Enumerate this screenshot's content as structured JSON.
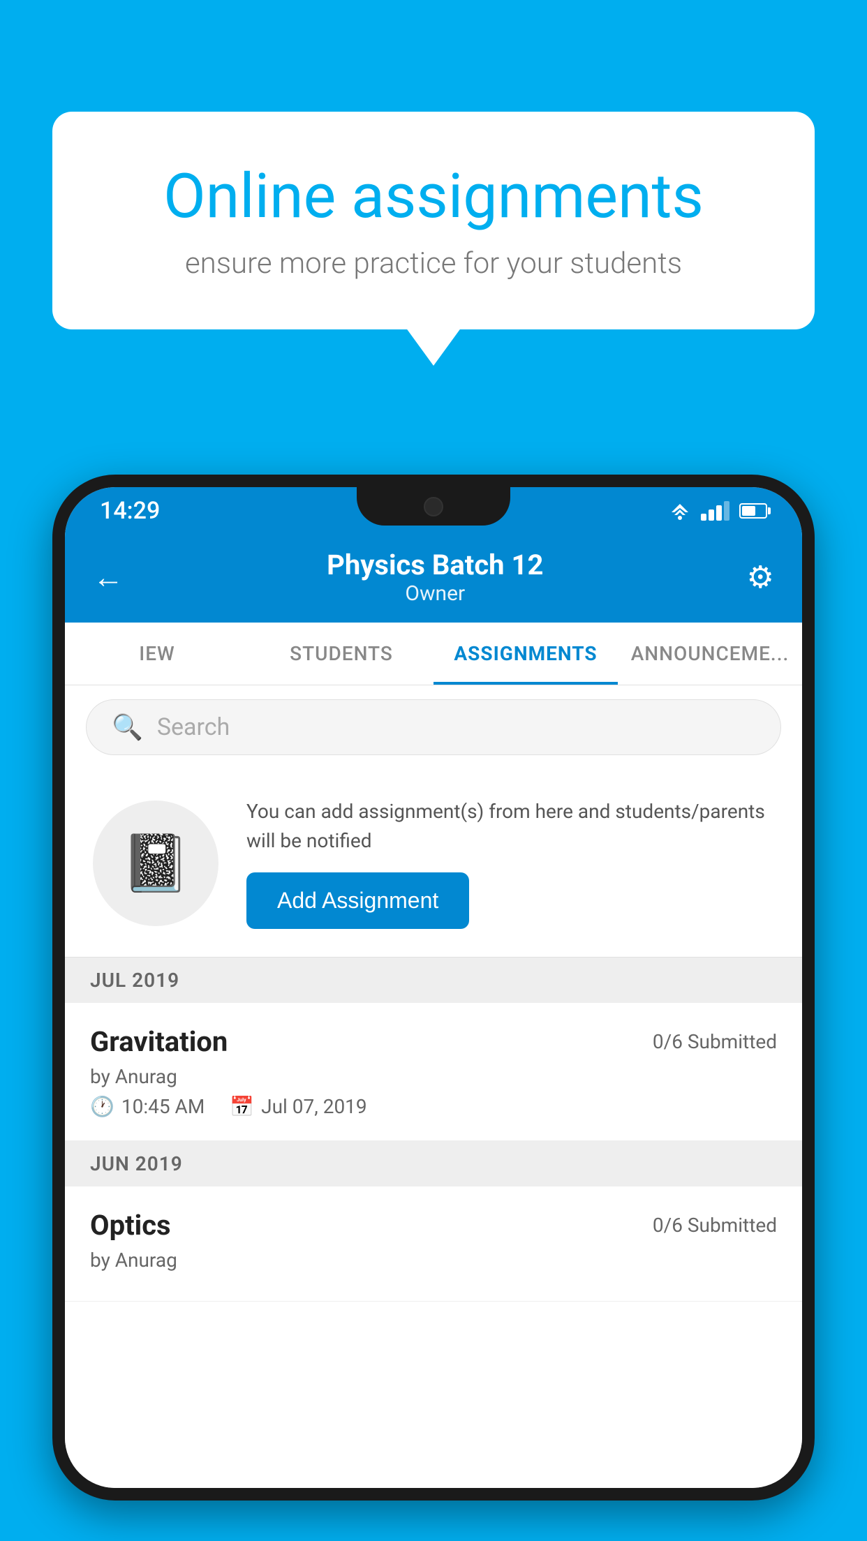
{
  "background_color": "#00AEEF",
  "promo": {
    "title": "Online assignments",
    "subtitle": "ensure more practice for your students"
  },
  "status_bar": {
    "time": "14:29"
  },
  "header": {
    "title": "Physics Batch 12",
    "subtitle": "Owner",
    "back_label": "←",
    "settings_label": "⚙"
  },
  "tabs": [
    {
      "label": "IEW",
      "active": false
    },
    {
      "label": "STUDENTS",
      "active": false
    },
    {
      "label": "ASSIGNMENTS",
      "active": true
    },
    {
      "label": "ANNOUNCEMENTS",
      "active": false
    }
  ],
  "search": {
    "placeholder": "Search"
  },
  "add_assignment_promo": {
    "description": "You can add assignment(s) from here and students/parents will be notified",
    "button_label": "Add Assignment"
  },
  "sections": [
    {
      "label": "JUL 2019",
      "assignments": [
        {
          "title": "Gravitation",
          "submitted": "0/6 Submitted",
          "author": "by Anurag",
          "time": "10:45 AM",
          "date": "Jul 07, 2019"
        }
      ]
    },
    {
      "label": "JUN 2019",
      "assignments": [
        {
          "title": "Optics",
          "submitted": "0/6 Submitted",
          "author": "by Anurag",
          "time": "",
          "date": ""
        }
      ]
    }
  ]
}
